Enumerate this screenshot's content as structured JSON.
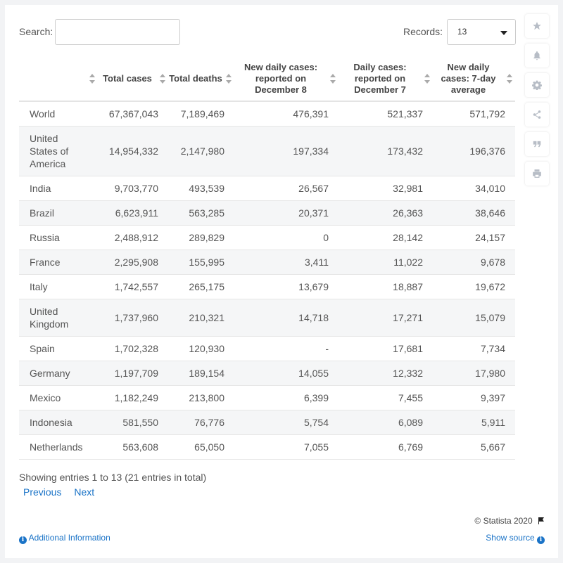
{
  "search": {
    "label": "Search:",
    "value": ""
  },
  "records": {
    "label": "Records:",
    "selected": "13"
  },
  "table": {
    "headers": [
      "",
      "Total cases",
      "Total deaths",
      "New daily cases: reported on December 8",
      "Daily cases: reported on December 7",
      "New daily cases: 7-day average"
    ],
    "rows": [
      [
        "World",
        "67,367,043",
        "7,189,469",
        "476,391",
        "521,337",
        "571,792"
      ],
      [
        "United States of America",
        "14,954,332",
        "2,147,980",
        "197,334",
        "173,432",
        "196,376"
      ],
      [
        "India",
        "9,703,770",
        "493,539",
        "26,567",
        "32,981",
        "34,010"
      ],
      [
        "Brazil",
        "6,623,911",
        "563,285",
        "20,371",
        "26,363",
        "38,646"
      ],
      [
        "Russia",
        "2,488,912",
        "289,829",
        "0",
        "28,142",
        "24,157"
      ],
      [
        "France",
        "2,295,908",
        "155,995",
        "3,411",
        "11,022",
        "9,678"
      ],
      [
        "Italy",
        "1,742,557",
        "265,175",
        "13,679",
        "18,887",
        "19,672"
      ],
      [
        "United Kingdom",
        "1,737,960",
        "210,321",
        "14,718",
        "17,271",
        "15,079"
      ],
      [
        "Spain",
        "1,702,328",
        "120,930",
        "-",
        "17,681",
        "7,734"
      ],
      [
        "Germany",
        "1,197,709",
        "189,154",
        "14,055",
        "12,332",
        "17,980"
      ],
      [
        "Mexico",
        "1,182,249",
        "213,800",
        "6,399",
        "7,455",
        "9,397"
      ],
      [
        "Indonesia",
        "581,550",
        "76,776",
        "5,754",
        "6,089",
        "5,911"
      ],
      [
        "Netherlands",
        "563,608",
        "65,050",
        "7,055",
        "6,769",
        "5,667"
      ]
    ]
  },
  "footer": {
    "info": "Showing entries 1 to 13 (21 entries in total)",
    "previous": "Previous",
    "next": "Next",
    "copyright": "© Statista 2020",
    "additional_info": "Additional Information",
    "show_source": "Show source"
  },
  "sidebar_icons": [
    "star-icon",
    "bell-icon",
    "gear-icon",
    "share-icon",
    "quote-icon",
    "print-icon"
  ],
  "colors": {
    "link": "#1a73c7",
    "stripe": "#f5f6f7",
    "icon": "#b7bdc6"
  }
}
